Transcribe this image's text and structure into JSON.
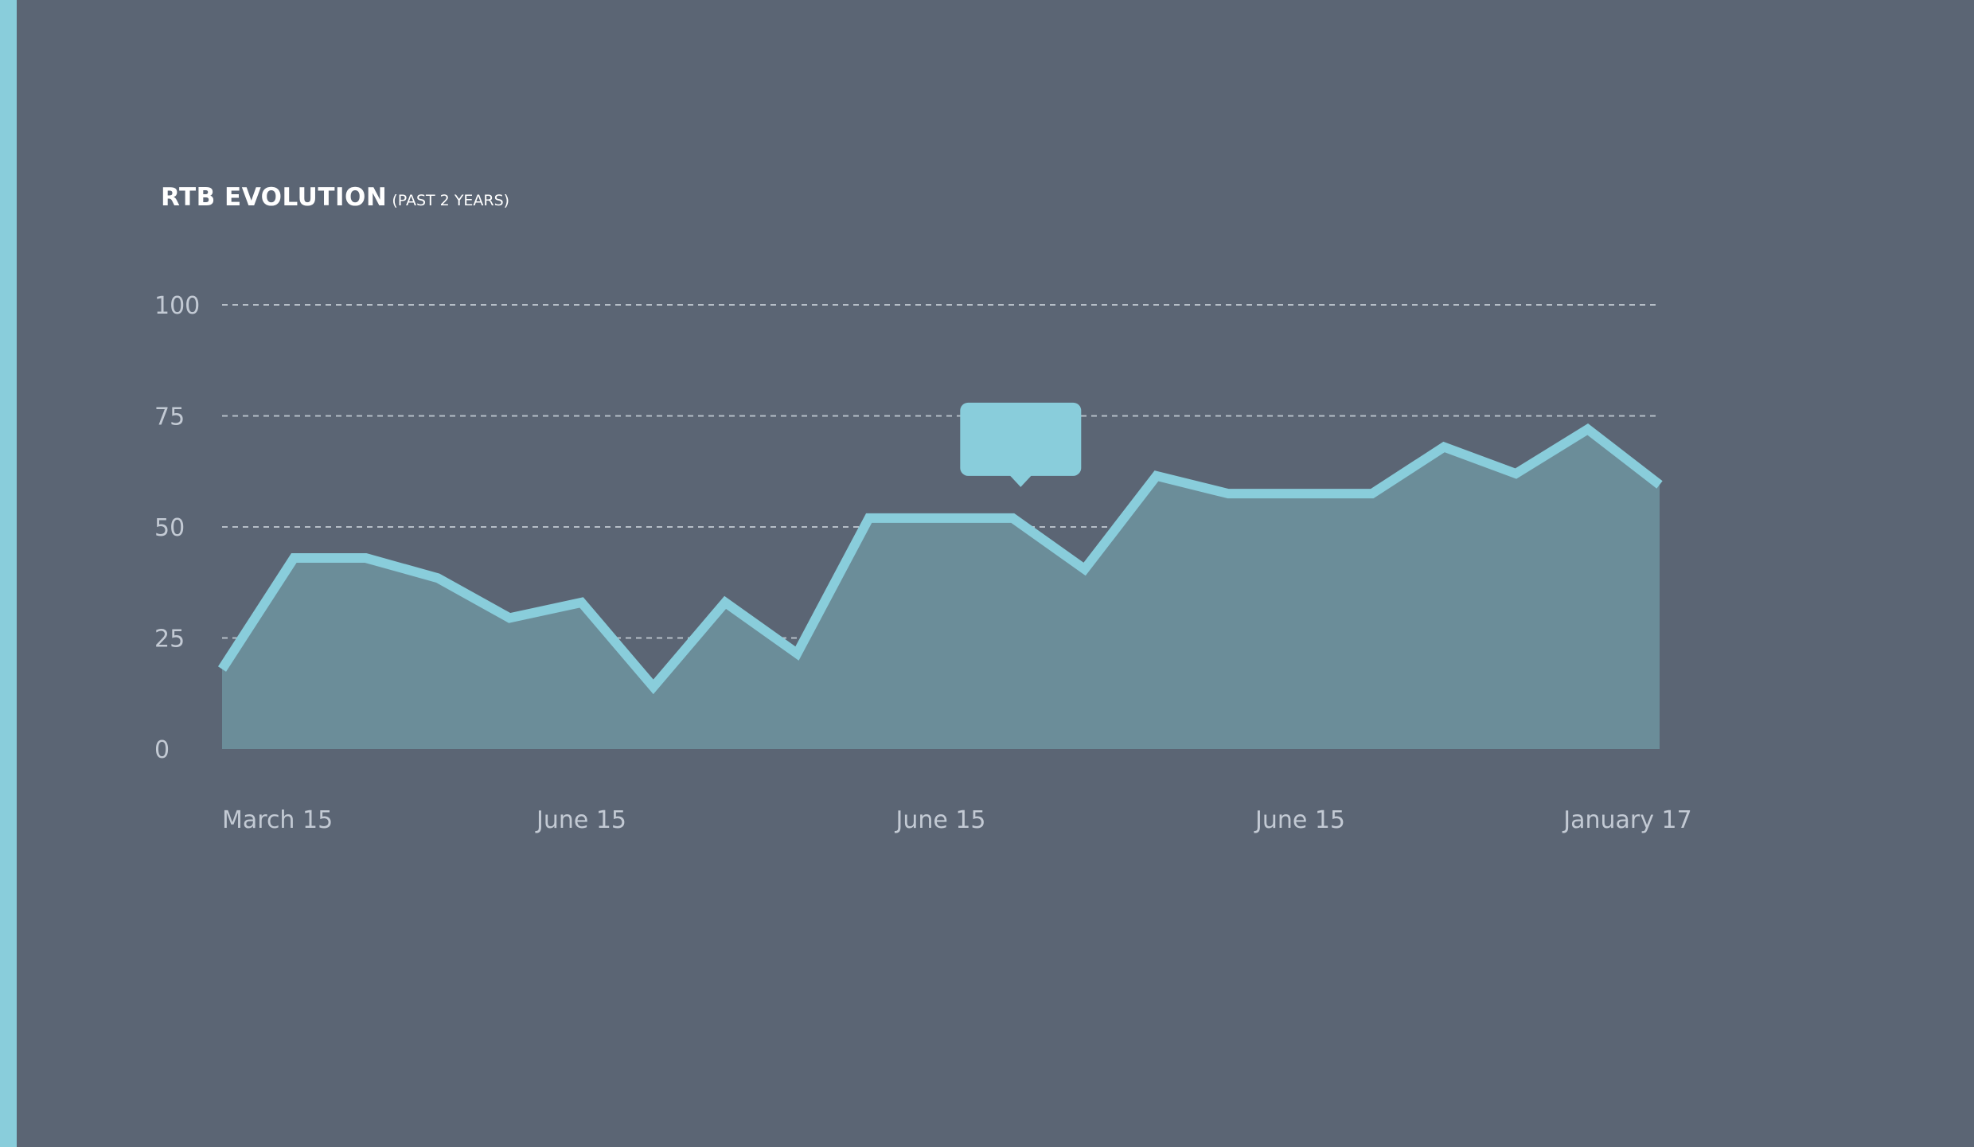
{
  "colors": {
    "background": "#5b6574",
    "accent": "#89cddb",
    "area_fill": "#6b8d99",
    "grid": "#c7ced6",
    "tick_text": "#c3cad4"
  },
  "chart_data": {
    "type": "area",
    "title": "RTB EVOLUTION",
    "subtitle": "(PAST 2 YEARS)",
    "ylim": [
      0,
      100
    ],
    "y_ticks": [
      0,
      25,
      50,
      75,
      100
    ],
    "grid": "dashed horizontal",
    "x_tick_labels": [
      "March 15",
      "June 15",
      "June 15",
      "June 15",
      "January 17"
    ],
    "series": [
      {
        "values": [
          18,
          43,
          43,
          38.5,
          29.5,
          33,
          14,
          33,
          21.5,
          52,
          52,
          52,
          40.5,
          61.5,
          57.5,
          57.5,
          57.5,
          68,
          62,
          72,
          59.5
        ]
      }
    ],
    "tooltip": {
      "point_index": 11,
      "text": ""
    }
  }
}
